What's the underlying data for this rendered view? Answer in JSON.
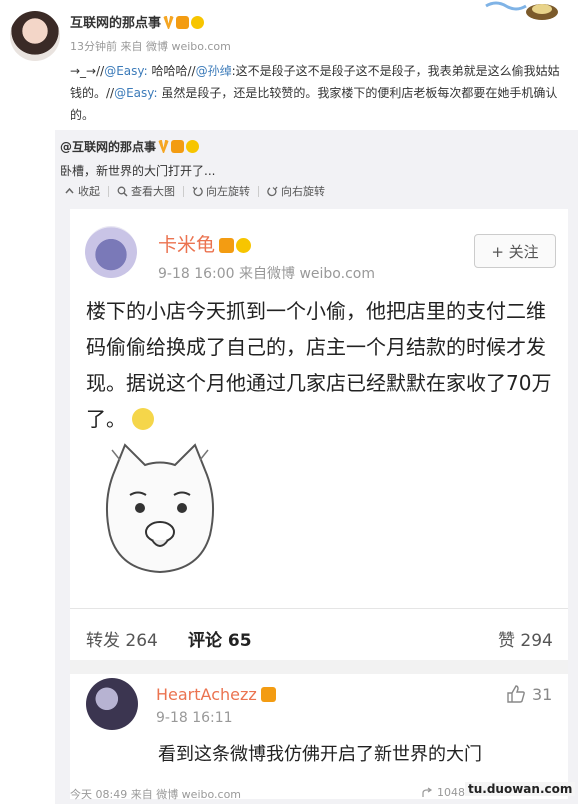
{
  "header": {
    "username": "互联网的那点事",
    "meta": "13分钟前 来自 微博 weibo.com",
    "post": {
      "prefix": "→_→//",
      "mention1": "@Easy:",
      "text1": " 哈哈哈//",
      "mention2": "@孙绰",
      "text2": ":这不是段子这不是段子这不是段子，我表弟就是这么偷我姑姑钱的。//",
      "mention3": "@Easy:",
      "text3": " 虽然是段子，还是比较赞的。我家楼下的便利店老板每次都要在她手机确认的。"
    }
  },
  "repost": {
    "name": "@互联网的那点事",
    "text": "卧槽，新世界的大门打开了...",
    "tools": {
      "collapse": "收起",
      "view_large": "查看大图",
      "rotate_left": "向左旋转",
      "rotate_right": "向右旋转"
    }
  },
  "card": {
    "name": "卡米龟",
    "meta": "9-18 16:00  来自微博 weibo.com",
    "follow": "+ 关注",
    "text": "楼下的小店今天抓到一个小偷，他把店里的支付二维码偷偷给换成了自己的，店主一个月结款的时候才发现。据说这个月他通过几家店已经默默在家收了70万了。",
    "stats": {
      "repost": "转发 264",
      "comment": "评论 65",
      "like": "赞 294"
    },
    "comment": {
      "name": "HeartAchezz",
      "time": "9-18 16:11",
      "likes": "31",
      "text": "看到这条微博我仿佛开启了新世界的大门"
    }
  },
  "footer": {
    "meta": "今天 08:49 来自 微博 weibo.com",
    "count": "1048",
    "watermark": "tu.duowan.com"
  },
  "colors": {
    "accent": "#eb7350",
    "mention": "#3c7bb9",
    "repost_bg": "#f2f2f5"
  }
}
